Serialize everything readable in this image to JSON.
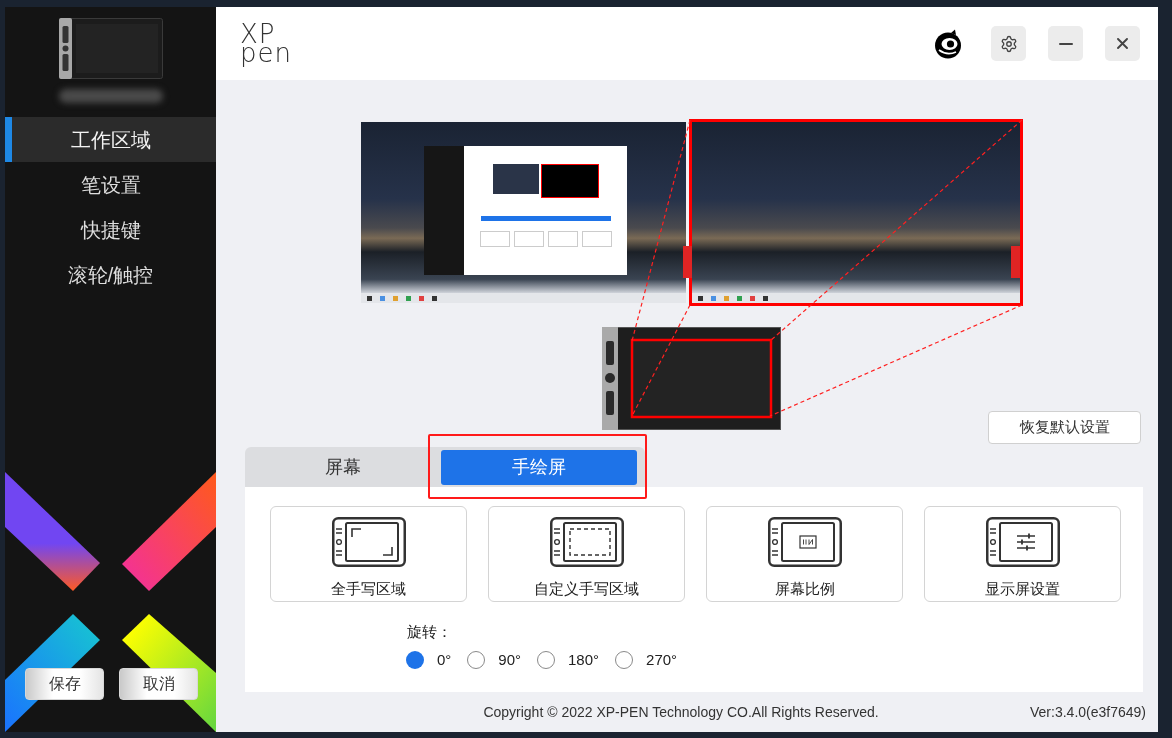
{
  "sidebar": {
    "items": [
      {
        "label": "工作区域",
        "selected": true
      },
      {
        "label": "笔设置",
        "selected": false
      },
      {
        "label": "快捷键",
        "selected": false
      },
      {
        "label": "滚轮/触控",
        "selected": false
      }
    ],
    "buttons": [
      {
        "label": "保存"
      },
      {
        "label": "取消"
      }
    ]
  },
  "header": {
    "logo": {
      "top": "XP",
      "bottom": "pen"
    }
  },
  "preview": {
    "monitors": [
      {
        "selected": false
      },
      {
        "selected": true
      }
    ],
    "reset_button": "恢复默认设置"
  },
  "tabs": [
    {
      "label": "屏幕",
      "selected": false
    },
    {
      "label": "手绘屏",
      "selected": true
    }
  ],
  "mapping_modes": [
    {
      "kind": "full",
      "label": "全手写区域"
    },
    {
      "kind": "custom",
      "label": "自定义手写区域"
    },
    {
      "kind": "ratio",
      "label": "屏幕比例"
    },
    {
      "kind": "display",
      "label": "显示屏设置"
    }
  ],
  "rotation": {
    "label": "旋转：",
    "options": [
      {
        "label": "0°",
        "selected": true
      },
      {
        "label": "90°",
        "selected": false
      },
      {
        "label": "180°",
        "selected": false
      },
      {
        "label": "270°",
        "selected": false
      }
    ]
  },
  "footer": {
    "copyright": "Copyright © 2022 XP-PEN Technology CO.All Rights Reserved.",
    "version": "Ver:3.4.0(e3f7649)"
  }
}
